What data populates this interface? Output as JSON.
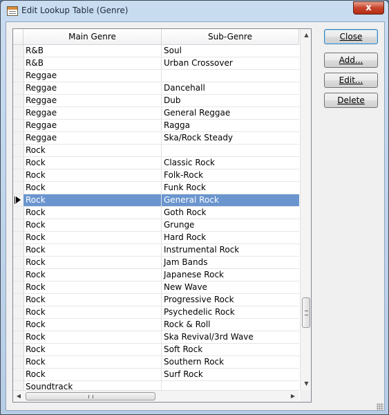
{
  "window": {
    "title": "Edit Lookup Table (Genre)",
    "close_glyph": "x"
  },
  "grid": {
    "columns": [
      "Main Genre",
      "Sub-Genre"
    ],
    "selected_index": 12,
    "rows": [
      [
        "R&B",
        "Soul"
      ],
      [
        "R&B",
        "Urban Crossover"
      ],
      [
        "Reggae",
        ""
      ],
      [
        "Reggae",
        "Dancehall"
      ],
      [
        "Reggae",
        "Dub"
      ],
      [
        "Reggae",
        "General Reggae"
      ],
      [
        "Reggae",
        "Ragga"
      ],
      [
        "Reggae",
        "Ska/Rock Steady"
      ],
      [
        "Rock",
        ""
      ],
      [
        "Rock",
        "Classic Rock"
      ],
      [
        "Rock",
        "Folk-Rock"
      ],
      [
        "Rock",
        "Funk Rock"
      ],
      [
        "Rock",
        "General Rock"
      ],
      [
        "Rock",
        "Goth Rock"
      ],
      [
        "Rock",
        "Grunge"
      ],
      [
        "Rock",
        "Hard Rock"
      ],
      [
        "Rock",
        "Instrumental Rock"
      ],
      [
        "Rock",
        "Jam Bands"
      ],
      [
        "Rock",
        "Japanese Rock"
      ],
      [
        "Rock",
        "New Wave"
      ],
      [
        "Rock",
        "Progressive Rock"
      ],
      [
        "Rock",
        "Psychedelic Rock"
      ],
      [
        "Rock",
        "Rock & Roll"
      ],
      [
        "Rock",
        "Ska Revival/3rd Wave"
      ],
      [
        "Rock",
        "Soft Rock"
      ],
      [
        "Rock",
        "Southern Rock"
      ],
      [
        "Rock",
        "Surf Rock"
      ],
      [
        "Soundtrack",
        ""
      ]
    ]
  },
  "buttons": {
    "close": "Close",
    "add": "Add...",
    "edit": "Edit...",
    "delete": "Delete"
  },
  "scroll_glyphs": {
    "up": "▲",
    "down": "▼",
    "left": "◀",
    "right": "▶"
  },
  "colors": {
    "selection": "#6a95cf",
    "title_close": "#c7432b"
  }
}
